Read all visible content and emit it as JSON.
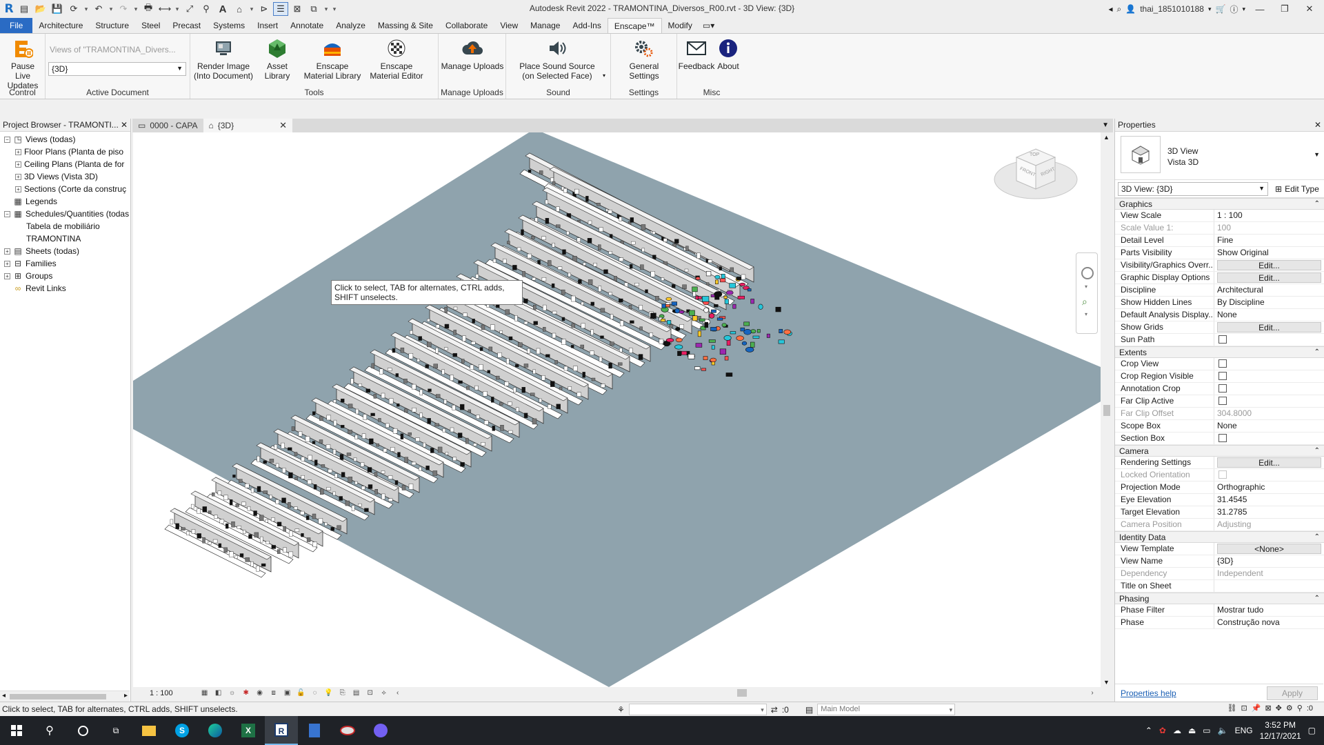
{
  "window": {
    "title": "Autodesk Revit 2022 - TRAMONTINA_Diversos_R00.rvt - 3D View: {3D}",
    "user": "thai_1851010188",
    "text_tool": "A"
  },
  "ribbon_tabs": [
    {
      "label": "File",
      "active": false,
      "file": true
    },
    {
      "label": "Architecture"
    },
    {
      "label": "Structure"
    },
    {
      "label": "Steel"
    },
    {
      "label": "Precast"
    },
    {
      "label": "Systems"
    },
    {
      "label": "Insert"
    },
    {
      "label": "Annotate"
    },
    {
      "label": "Analyze"
    },
    {
      "label": "Massing & Site"
    },
    {
      "label": "Collaborate"
    },
    {
      "label": "View"
    },
    {
      "label": "Manage"
    },
    {
      "label": "Add-Ins"
    },
    {
      "label": "Enscape™",
      "active": true
    },
    {
      "label": "Modify"
    }
  ],
  "ribbon": {
    "control": {
      "label": "Control",
      "pause_btn": "Pause Live Updates"
    },
    "active_document": {
      "label": "Active Document",
      "views_of": "Views of \"TRAMONTINA_Divers...",
      "selected_view": "{3D}"
    },
    "tools": {
      "label": "Tools",
      "render_image": "Render Image (Into Document)",
      "asset_library": "Asset Library",
      "material_library": "Enscape Material Library",
      "material_editor": "Enscape Material Editor"
    },
    "manage_uploads": {
      "label": "Manage Uploads",
      "btn": "Manage Uploads"
    },
    "sound": {
      "label": "Sound",
      "btn": "Place Sound Source (on Selected Face)"
    },
    "settings": {
      "label": "Settings",
      "btn": "General Settings"
    },
    "misc": {
      "label": "Misc",
      "feedback": "Feedback",
      "about": "About"
    }
  },
  "project_browser": {
    "title": "Project Browser - TRAMONTI...",
    "items": [
      {
        "label": "Views (todas)",
        "level": 0,
        "toggle": "−",
        "icon": "views"
      },
      {
        "label": "Floor Plans (Planta de piso",
        "level": 1,
        "toggle": "+"
      },
      {
        "label": "Ceiling Plans (Planta de for",
        "level": 1,
        "toggle": "+"
      },
      {
        "label": "3D Views (Vista 3D)",
        "level": 1,
        "toggle": "+"
      },
      {
        "label": "Sections (Corte da construç",
        "level": 1,
        "toggle": "+"
      },
      {
        "label": "Legends",
        "level": 0,
        "toggle": "",
        "icon": "legend"
      },
      {
        "label": "Schedules/Quantities (todas",
        "level": 0,
        "toggle": "−",
        "icon": "schedule"
      },
      {
        "label": "Tabela de mobiliário",
        "level": 2,
        "toggle": ""
      },
      {
        "label": "TRAMONTINA",
        "level": 2,
        "toggle": ""
      },
      {
        "label": "Sheets (todas)",
        "level": 0,
        "toggle": "+",
        "icon": "sheet"
      },
      {
        "label": "Families",
        "level": 0,
        "toggle": "+",
        "icon": "family"
      },
      {
        "label": "Groups",
        "level": 0,
        "toggle": "+",
        "icon": "group"
      },
      {
        "label": "Revit Links",
        "level": 0,
        "toggle": "",
        "icon": "link"
      }
    ]
  },
  "view_tabs": [
    {
      "label": "0000 - CAPA",
      "active": false
    },
    {
      "label": "{3D}",
      "active": true
    }
  ],
  "canvas": {
    "tooltip": "Click to select, TAB for alternates, CTRL adds, SHIFT unselects.",
    "viewcube": {
      "top": "TOP",
      "front": "FRONT",
      "right": "RIGHT"
    }
  },
  "view_control": {
    "scale": "1 : 100"
  },
  "properties": {
    "title": "Properties",
    "type_name_line1": "3D View",
    "type_name_line2": "Vista 3D",
    "selector": "3D View: {3D}",
    "edit_type": "Edit Type",
    "sections": [
      {
        "name": "Graphics",
        "rows": [
          {
            "k": "View Scale",
            "v": "1 : 100"
          },
          {
            "k": "Scale Value    1:",
            "v": "100",
            "dim": true
          },
          {
            "k": "Detail Level",
            "v": "Fine"
          },
          {
            "k": "Parts Visibility",
            "v": "Show Original"
          },
          {
            "k": "Visibility/Graphics Overr...",
            "btn": "Edit..."
          },
          {
            "k": "Graphic Display Options",
            "btn": "Edit..."
          },
          {
            "k": "Discipline",
            "v": "Architectural"
          },
          {
            "k": "Show Hidden Lines",
            "v": "By Discipline"
          },
          {
            "k": "Default Analysis Display...",
            "v": "None"
          },
          {
            "k": "Show Grids",
            "btn": "Edit..."
          },
          {
            "k": "Sun Path",
            "chk": true
          }
        ]
      },
      {
        "name": "Extents",
        "rows": [
          {
            "k": "Crop View",
            "chk": true
          },
          {
            "k": "Crop Region Visible",
            "chk": true
          },
          {
            "k": "Annotation Crop",
            "chk": true
          },
          {
            "k": "Far Clip Active",
            "chk": true
          },
          {
            "k": "Far Clip Offset",
            "v": "304.8000",
            "dim": true
          },
          {
            "k": "Scope Box",
            "v": "None"
          },
          {
            "k": "Section Box",
            "chk": true
          }
        ]
      },
      {
        "name": "Camera",
        "rows": [
          {
            "k": "Rendering Settings",
            "btn": "Edit..."
          },
          {
            "k": "Locked Orientation",
            "chk": true,
            "dim": true
          },
          {
            "k": "Projection Mode",
            "v": "Orthographic"
          },
          {
            "k": "Eye Elevation",
            "v": "31.4545"
          },
          {
            "k": "Target Elevation",
            "v": "31.2785"
          },
          {
            "k": "Camera Position",
            "v": "Adjusting",
            "dim": true
          }
        ]
      },
      {
        "name": "Identity Data",
        "rows": [
          {
            "k": "View Template",
            "btn": "<None>"
          },
          {
            "k": "View Name",
            "v": "{3D}"
          },
          {
            "k": "Dependency",
            "v": "Independent",
            "dim": true
          },
          {
            "k": "Title on Sheet",
            "v": ""
          }
        ]
      },
      {
        "name": "Phasing",
        "rows": [
          {
            "k": "Phase Filter",
            "v": "Mostrar tudo"
          },
          {
            "k": "Phase",
            "v": "Construção nova"
          }
        ]
      }
    ],
    "help": "Properties help",
    "apply": "Apply"
  },
  "status": {
    "text": "Click to select, TAB for alternates, CTRL adds, SHIFT unselects.",
    "selection_count": ":0",
    "workset": "Main Model",
    "filter_count": ":0"
  },
  "taskbar": {
    "lang": "ENG",
    "time": "3:52 PM",
    "date": "12/17/2021"
  },
  "colors": {
    "file_tab": "#2a6bc4",
    "floor": "#8fa3ad",
    "canvas_bg": "#ffffff",
    "taskbar": "#1f2227"
  }
}
